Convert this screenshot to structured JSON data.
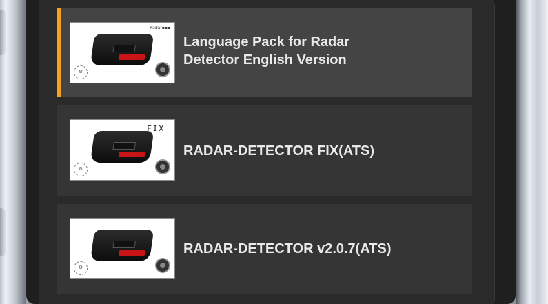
{
  "mods": [
    {
      "title_line1": "Language Pack for Radar",
      "title_line2": "Detector English Version",
      "thumbnail_label": "",
      "selected": true
    },
    {
      "title": "RADAR-DETECTOR FIX(ATS)",
      "thumbnail_label": "FIX",
      "selected": false
    },
    {
      "title": "RADAR-DETECTOR v2.0.7(ATS)",
      "thumbnail_label": "",
      "selected": false
    }
  ],
  "colors": {
    "accent": "#f4a21c",
    "selected_bg": "#444444",
    "item_bg": "#353535",
    "text": "#e9e9e9"
  },
  "icons": [
    "radar-detector-thumbnail-icon"
  ]
}
